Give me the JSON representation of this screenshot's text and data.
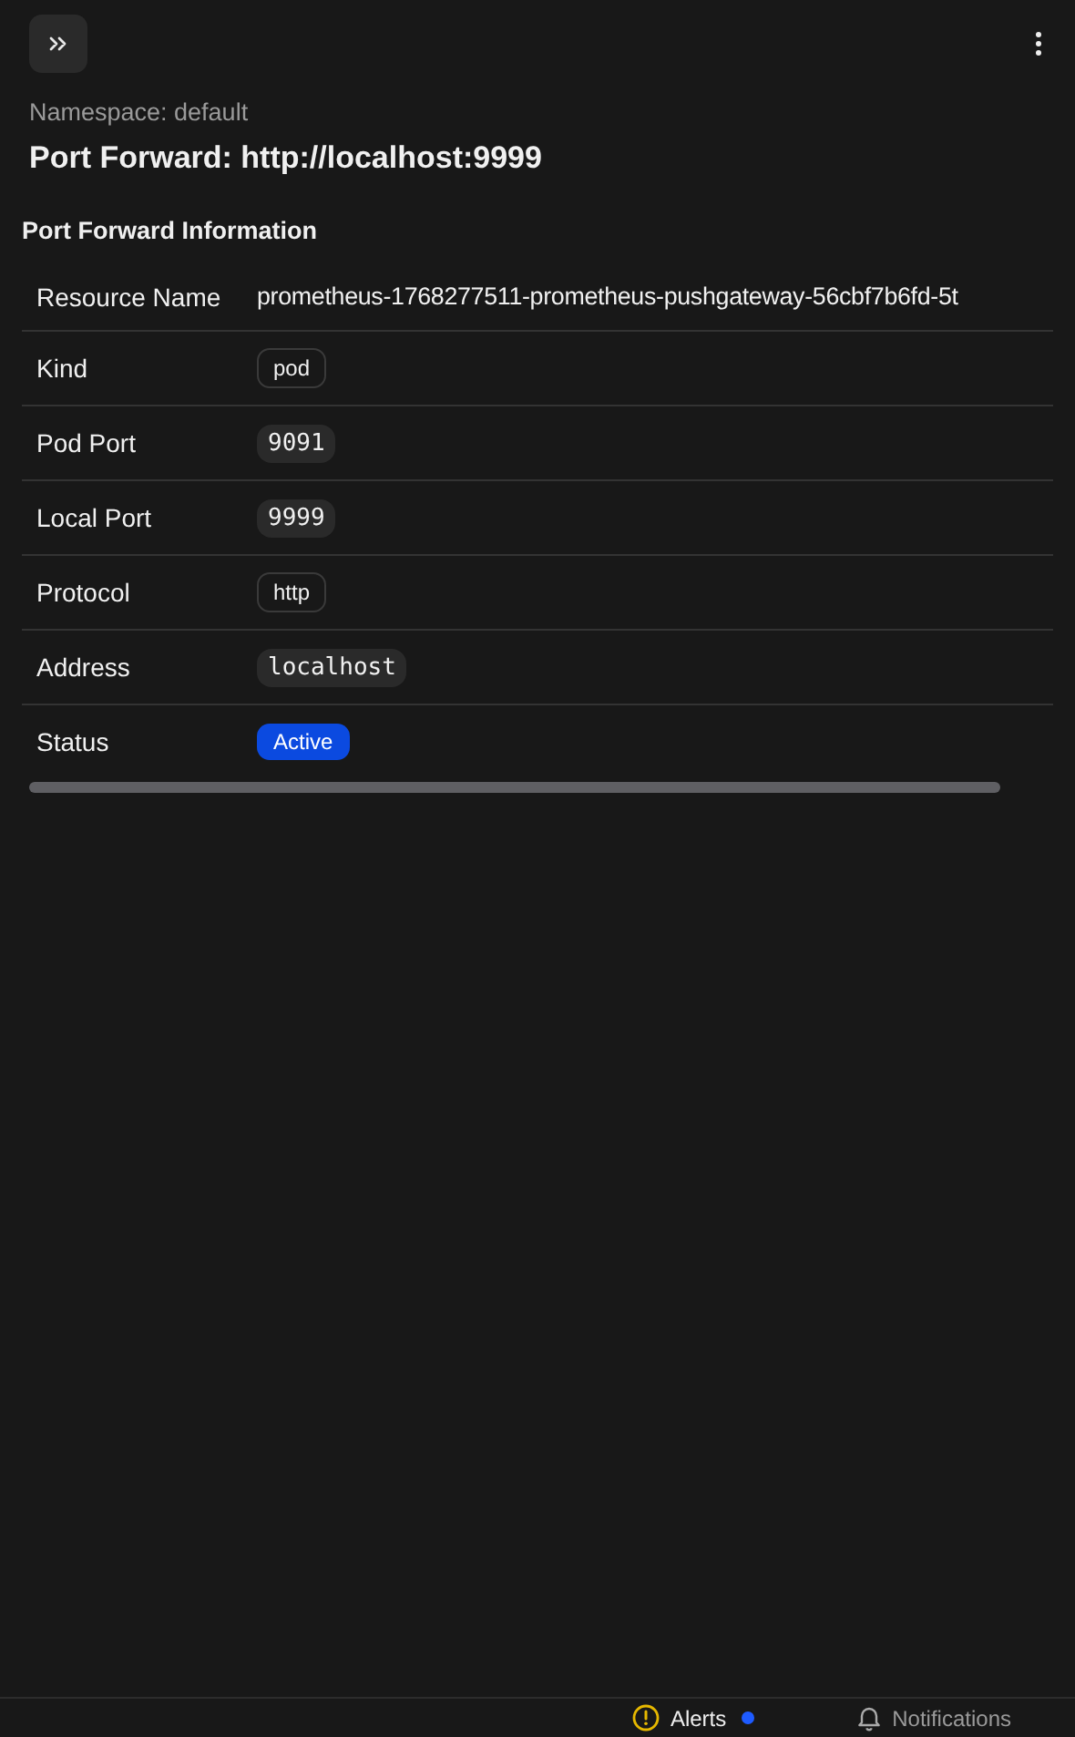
{
  "header": {
    "namespace": "Namespace: default",
    "title": "Port Forward: http://localhost:9999"
  },
  "section": {
    "title": "Port Forward Information"
  },
  "rows": [
    {
      "label": "Resource Name",
      "value": "prometheus-1768277511-prometheus-pushgateway-56cbf7b6fd-5t",
      "kind": "text"
    },
    {
      "label": "Kind",
      "value": "pod",
      "kind": "tag"
    },
    {
      "label": "Pod Port",
      "value": "9091",
      "kind": "code"
    },
    {
      "label": "Local Port",
      "value": "9999",
      "kind": "code"
    },
    {
      "label": "Protocol",
      "value": "http",
      "kind": "tag"
    },
    {
      "label": "Address",
      "value": "localhost",
      "kind": "code"
    },
    {
      "label": "Status",
      "value": "Active",
      "kind": "status"
    }
  ],
  "status_bar": {
    "alerts": {
      "label": "Alerts",
      "unread": true
    },
    "notifications": {
      "label": "Notifications"
    }
  }
}
